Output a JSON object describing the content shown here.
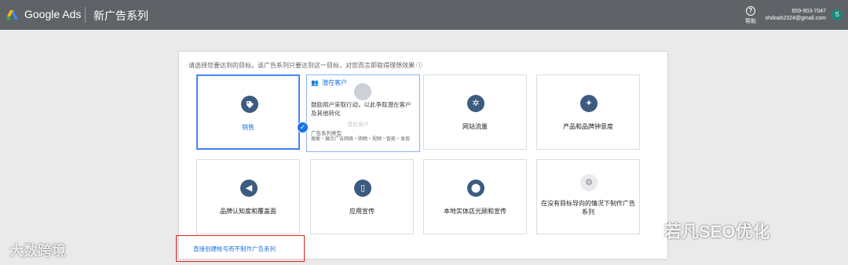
{
  "header": {
    "app_name": "Google Ads",
    "page_title": "新广告系列",
    "help_label": "帮助",
    "account_phone": "659-903-7047",
    "account_email": "shdoah2324@gmail.com",
    "avatar_letter": "S"
  },
  "prompt": "请选择您要达到的目标。该广告系列只要达到这一目标，对您而言即取得理想效果 ⓘ",
  "goals": [
    {
      "label": "销售",
      "icon": "tag-icon",
      "selected": true
    },
    {
      "label": "潜在客户",
      "icon": "people-icon",
      "expanded": true,
      "desc": "鼓励用户采取行动，以此争取潜在客户及其他转化",
      "ghost_label": "潜在客户",
      "type_heading": "广告系列类型",
      "types": "搜索・展示广告网络・购物・视频・智能・发现"
    },
    {
      "label": "网站流量",
      "icon": "cursor-sparkle-icon"
    },
    {
      "label": "产品和品牌钟意度",
      "icon": "sparkle-icon"
    },
    {
      "label": "品牌认知度和覆盖面",
      "icon": "megaphone-icon"
    },
    {
      "label": "应用宣传",
      "icon": "phone-icon"
    },
    {
      "label": "本地实体店光顾和宣传",
      "icon": "map-pin-icon"
    },
    {
      "label": "在没有目标导向的情况下制作广告系列",
      "icon": "gear-icon"
    }
  ],
  "create_link": "直接创建帐号而不制作广告系列",
  "watermarks": {
    "left": "大数跨境",
    "right": "若凡SEO优化"
  },
  "colors": {
    "topbar": "#5f6368",
    "accent": "#1a73e8",
    "icon_bg": "#3c5b80",
    "highlight": "#e02020"
  }
}
